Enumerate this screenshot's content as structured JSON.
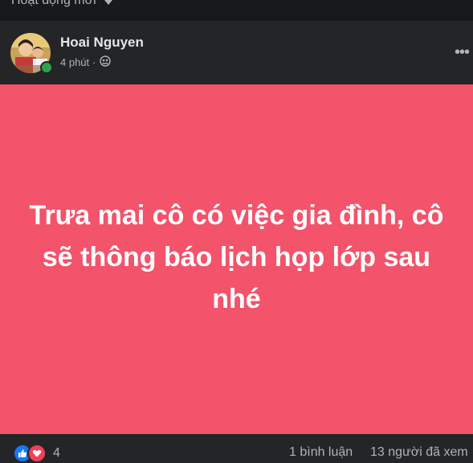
{
  "feed": {
    "sort_label": "Hoạt động mới"
  },
  "post": {
    "author": "Hoai Nguyen",
    "time": "4 phút",
    "separator": "·",
    "audience_icon": "group-audience-icon",
    "more_icon": "more-options-icon",
    "text": "Trưa mai cô có việc gia đình, cô sẽ thông báo lịch họp lớp sau nhé",
    "background_color": "#f3536b",
    "online": true,
    "reactions": {
      "types": [
        "like",
        "love"
      ],
      "count": "4"
    },
    "comments": "1 bình luận",
    "views": "13 người đã xem"
  }
}
